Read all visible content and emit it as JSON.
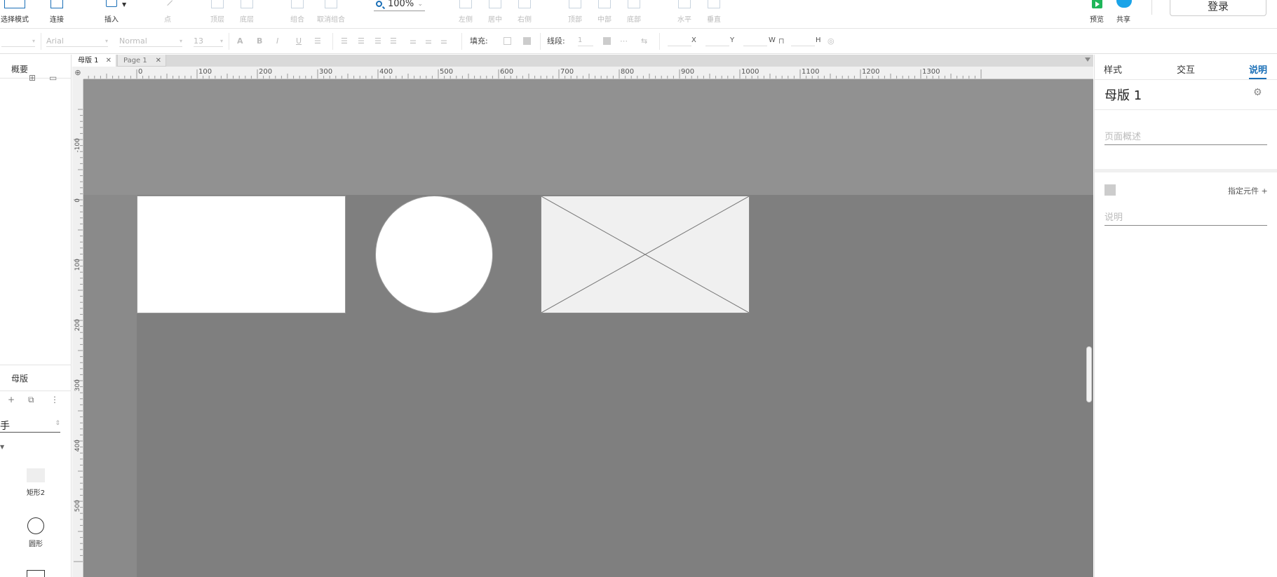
{
  "toolbar": {
    "select_mode": "选择模式",
    "connect": "连接",
    "insert": "插入",
    "point": "点",
    "top_layer": "顶层",
    "bottom_layer": "底层",
    "group": "组合",
    "ungroup": "取消组合",
    "zoom": "100%",
    "align_left": "左侧",
    "align_center": "居中",
    "align_right": "右侧",
    "align_top": "顶部",
    "align_middle": "中部",
    "align_bottom": "底部",
    "distribute_h": "水平",
    "distribute_v": "垂直",
    "preview": "预览",
    "share": "共享",
    "login": "登录"
  },
  "formatbar": {
    "font_family": "Arial",
    "font_style": "Normal",
    "font_size": "13",
    "fill_label": "填充:",
    "stroke_label": "线段:",
    "stroke_width": "1",
    "x_label": "X",
    "y_label": "Y",
    "w_label": "W",
    "h_label": "H"
  },
  "left_panel": {
    "outline_title": "概要",
    "masters_title": "母版",
    "library_select": "手",
    "items": [
      {
        "label": "矩形2"
      },
      {
        "label": "圆形"
      }
    ]
  },
  "tabs": [
    {
      "label": "母版 1",
      "active": true
    },
    {
      "label": "Page 1",
      "active": false
    }
  ],
  "ruler": {
    "h_labels": [
      "0",
      "100",
      "200",
      "300",
      "400",
      "500",
      "600",
      "700",
      "800",
      "900",
      "1000",
      "1100",
      "1200",
      "1300"
    ],
    "v_labels": [
      "-100",
      "0",
      "100",
      "200",
      "300",
      "400",
      "500"
    ]
  },
  "right_panel": {
    "tabs": [
      "样式",
      "交互",
      "说明"
    ],
    "active_tab": "说明",
    "title": "母版 1",
    "page_desc_placeholder": "页面概述",
    "assign_label": "指定元件 +",
    "note_placeholder": "说明"
  },
  "colors": {
    "accent": "#1a6fb7",
    "canvas": "#7f7f7f",
    "master_band": "#919191",
    "preview": "#1fb65a",
    "share": "#1aa3e8"
  }
}
